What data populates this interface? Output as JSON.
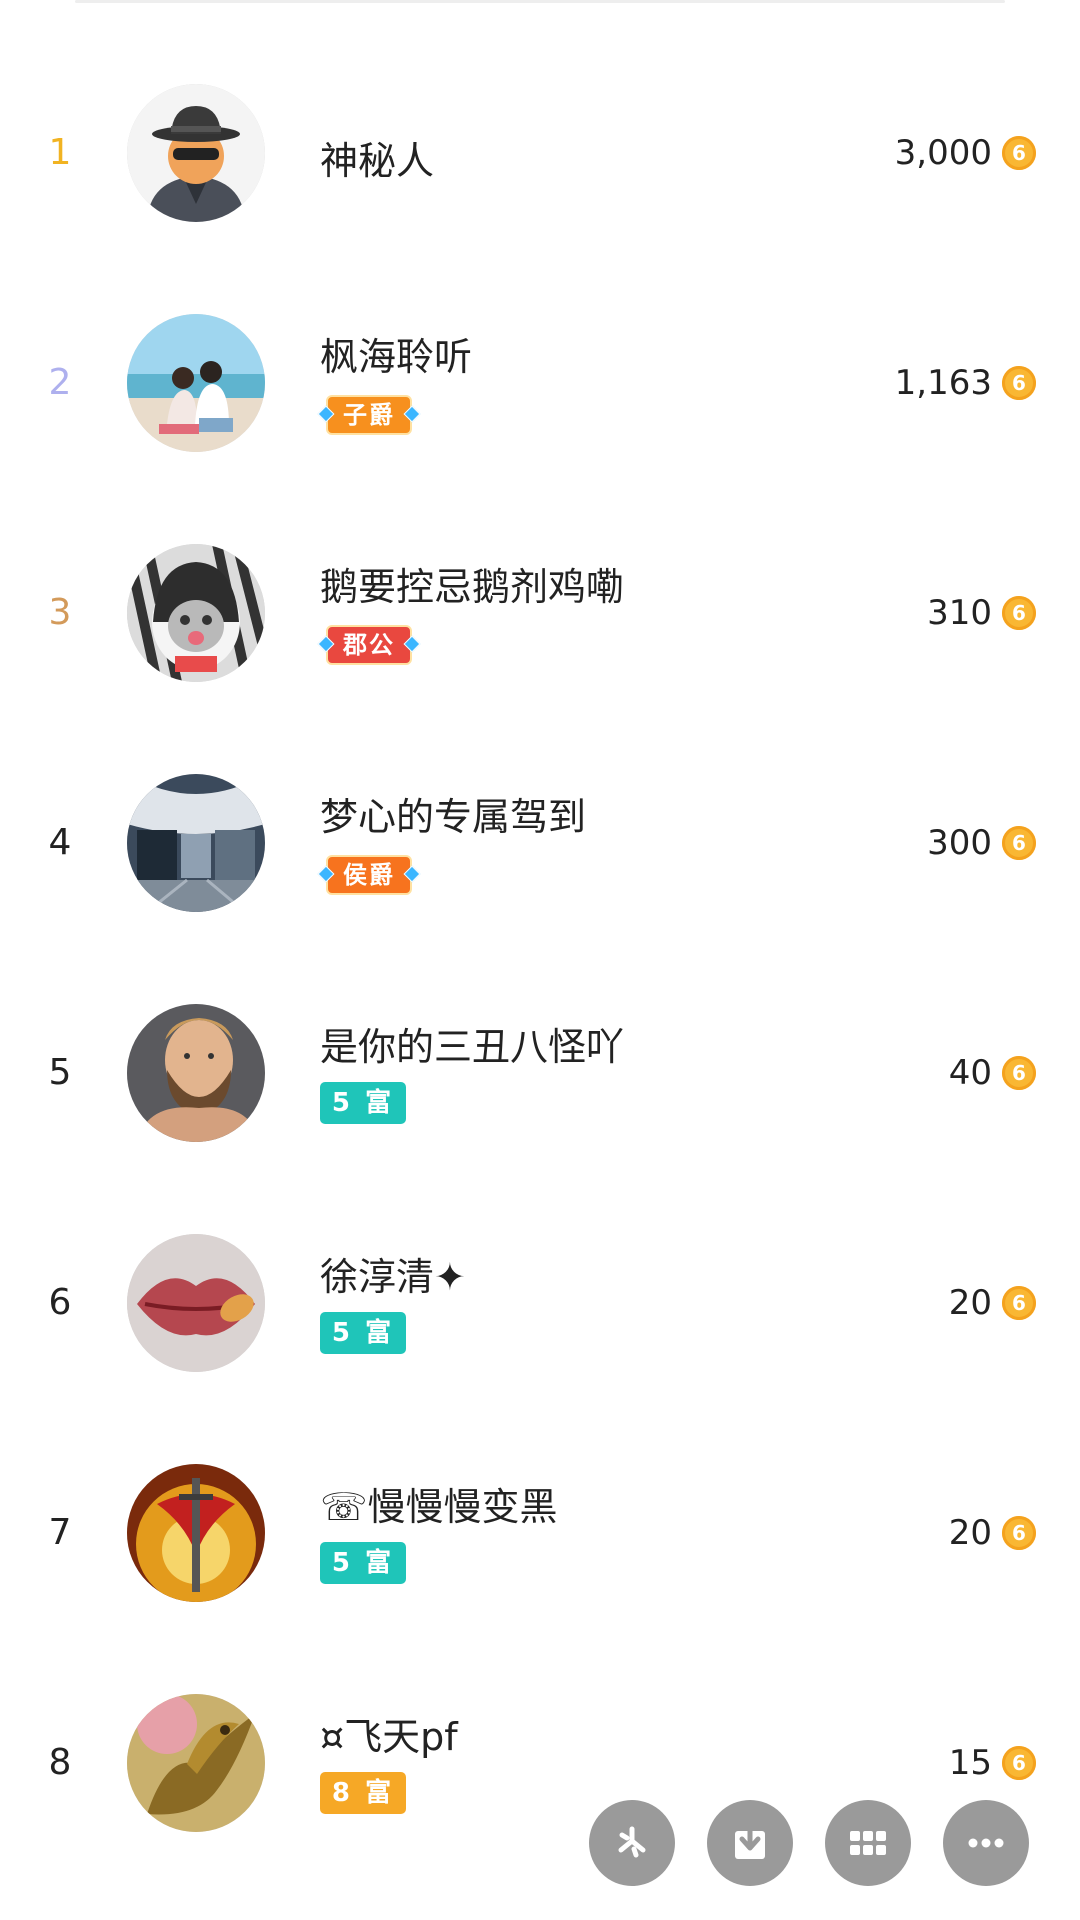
{
  "list": [
    {
      "rank": "1",
      "name": "神秘人",
      "amount": "3,000",
      "rank_color": "#f1b322"
    },
    {
      "rank": "2",
      "name": "枫海聆听",
      "badge": "子爵",
      "amount": "1,163",
      "rank_color": "#aeb0ee"
    },
    {
      "rank": "3",
      "name": "鹅要控忌鹅剂鸡嘞",
      "badge": "郡公",
      "amount": "310",
      "rank_color": "#d39a5a"
    },
    {
      "rank": "4",
      "name": "梦心的专属驾到",
      "badge": "侯爵",
      "amount": "300",
      "rank_color": "#222222"
    },
    {
      "rank": "5",
      "name": "是你的三丑八怪吖",
      "badge": "5 富",
      "amount": "40",
      "rank_color": "#222222"
    },
    {
      "rank": "6",
      "name": "徐淳清✦",
      "badge": "5 富",
      "amount": "20",
      "rank_color": "#222222"
    },
    {
      "rank": "7",
      "name": "☏慢慢慢变黑",
      "badge": "5 富",
      "amount": "20",
      "rank_color": "#222222"
    },
    {
      "rank": "8",
      "name": "¤飞天pf",
      "badge": "8 富",
      "amount": "15",
      "rank_color": "#222222"
    }
  ],
  "coin_glyph": "6",
  "colors": {
    "rich_badge": "#1fc5b9",
    "rich8_badge": "#f6a826",
    "viscount_badge": "#f7901e",
    "duke_badge": "#e9483f",
    "marquis_badge": "#f7731e",
    "coin": "#f9b733",
    "fab": "#9a9a9a"
  },
  "fab_icons": [
    "pinwheel-icon",
    "download-icon",
    "grid-icon",
    "more-icon"
  ]
}
